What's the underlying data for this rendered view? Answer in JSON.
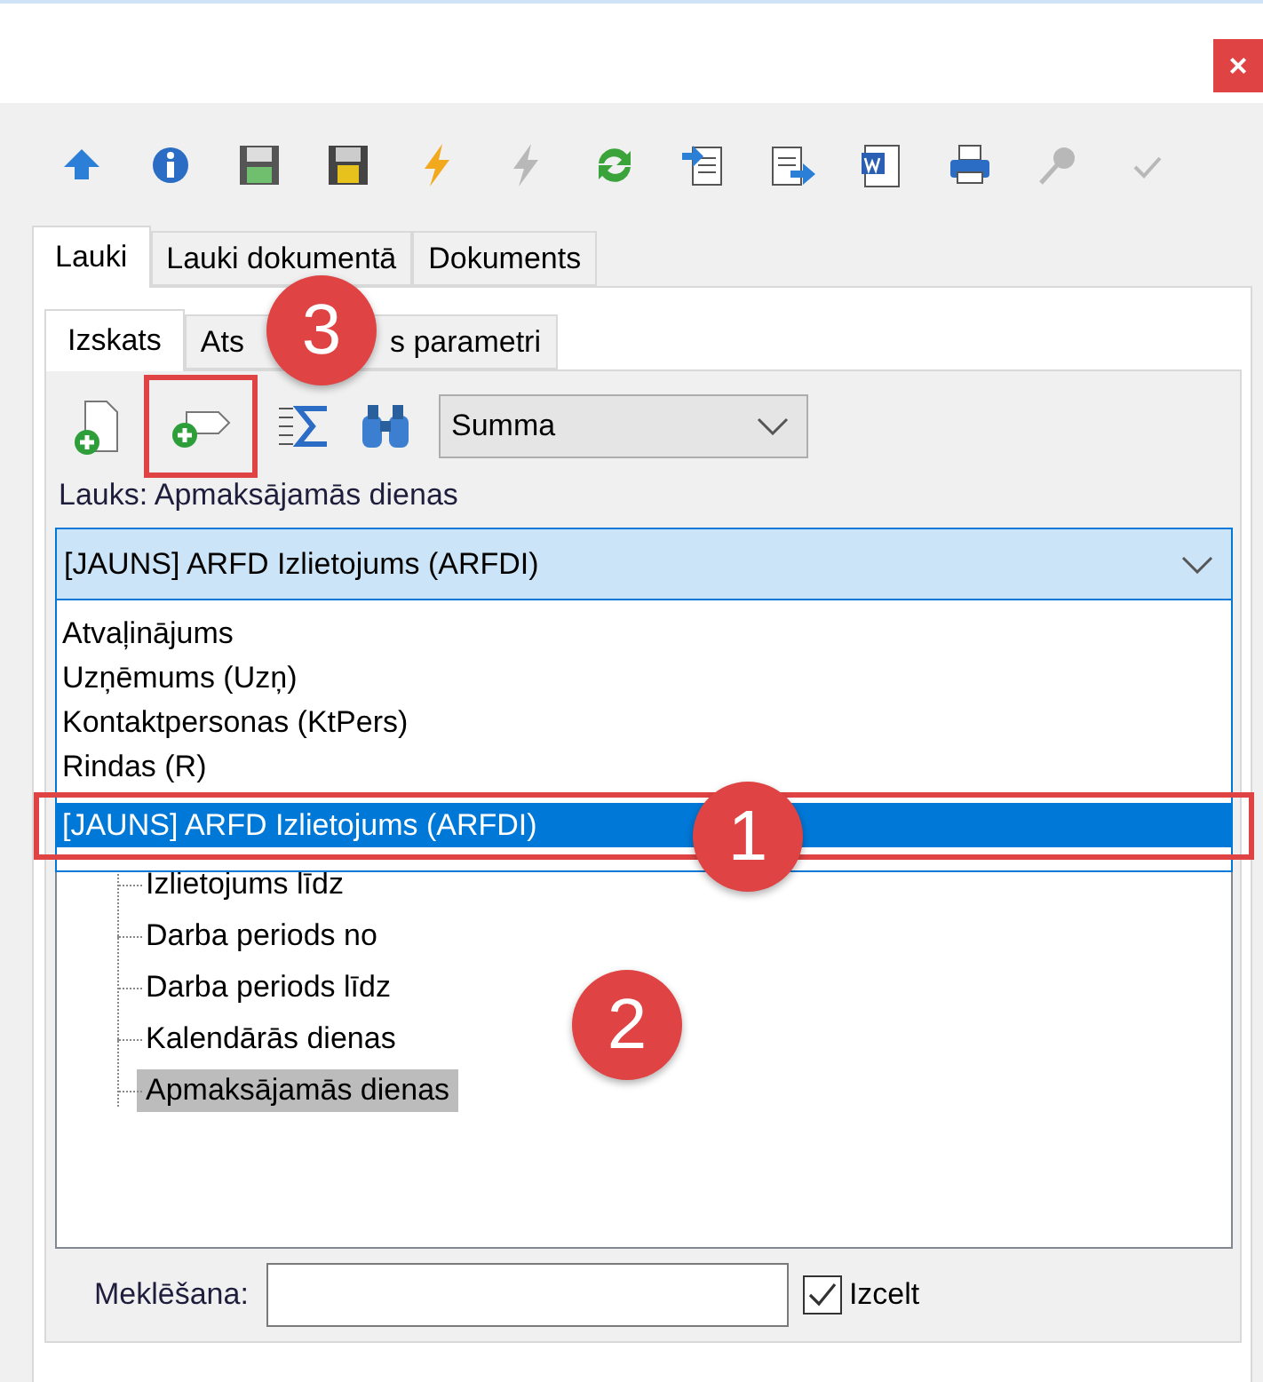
{
  "window": {
    "close": "×"
  },
  "toolbar": [
    {
      "kind": "home",
      "disabled": false
    },
    {
      "kind": "info",
      "disabled": false
    },
    {
      "kind": "save",
      "disabled": false
    },
    {
      "kind": "save-as",
      "disabled": false
    },
    {
      "kind": "bolt",
      "disabled": false
    },
    {
      "kind": "bolt",
      "disabled": true
    },
    {
      "kind": "refresh",
      "disabled": false
    },
    {
      "kind": "import",
      "disabled": false
    },
    {
      "kind": "export",
      "disabled": false
    },
    {
      "kind": "word",
      "disabled": false
    },
    {
      "kind": "print",
      "disabled": false
    },
    {
      "kind": "pin",
      "disabled": true
    },
    {
      "kind": "check",
      "disabled": true
    }
  ],
  "tabs": [
    {
      "label": "Lauki",
      "selected": true
    },
    {
      "label": "Lauki dokumentā",
      "selected": false
    },
    {
      "label": "Dokuments",
      "selected": false
    }
  ],
  "subtabs": [
    {
      "parts": [
        "Izskats"
      ],
      "selected": true
    },
    {
      "parts": [
        "Ats",
        "s parametri"
      ],
      "selected": false
    }
  ],
  "field_tools": [
    {
      "kind": "add-doc",
      "outlined": false
    },
    {
      "kind": "add-field",
      "outlined": true
    },
    {
      "kind": "sum",
      "outlined": false
    },
    {
      "kind": "find",
      "outlined": false
    }
  ],
  "aggregate_select": {
    "value": "Summa"
  },
  "field_label": "Lauks: Apmaksājamās dienas",
  "source_combo": {
    "value": "[JAUNS] ARFD Izlietojums (ARFDI)",
    "expanded": true,
    "options": [
      {
        "label": "Atvaļinājums",
        "selected": false,
        "outlined": false
      },
      {
        "label": "Uzņēmums (Uzņ)",
        "selected": false,
        "outlined": false
      },
      {
        "label": "Kontaktpersonas (KtPers)",
        "selected": false,
        "outlined": false
      },
      {
        "label": "Rindas (R)",
        "selected": false,
        "outlined": false
      },
      {
        "label": "[JAUNS] ARFD Izlietojums (ARFDI)",
        "selected": true,
        "outlined": true
      }
    ]
  },
  "tree": [
    {
      "label": "Izlietojums līdz",
      "selected": false
    },
    {
      "label": "Darba periods no",
      "selected": false
    },
    {
      "label": "Darba periods līdz",
      "selected": false
    },
    {
      "label": "Kalendārās dienas",
      "selected": false
    },
    {
      "label": "Apmaksājamās dienas",
      "selected": true
    }
  ],
  "search": {
    "label": "Meklēšana:"
  },
  "highlight": {
    "label": "Izcelt",
    "checked": true
  },
  "badges": [
    "3",
    "1",
    "2"
  ]
}
